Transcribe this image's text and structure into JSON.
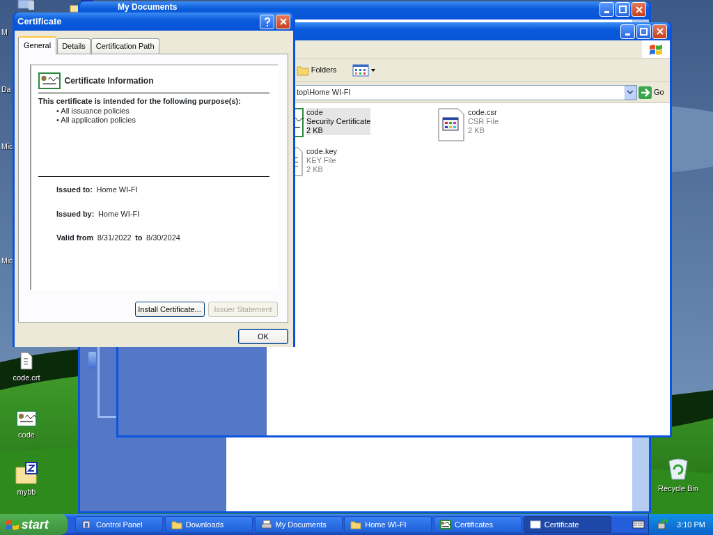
{
  "desktop_icons": [
    {
      "label": "M",
      "kind": "hidden"
    },
    {
      "label": "Da",
      "kind": "hidden"
    },
    {
      "label": "Mic",
      "kind": "hidden"
    },
    {
      "label": "Mic",
      "kind": "hidden"
    },
    {
      "label": "code.crt",
      "kind": "document"
    },
    {
      "label": "code",
      "kind": "certificate"
    },
    {
      "label": "mybb",
      "kind": "zip-folder"
    },
    {
      "label": "Recycle Bin",
      "kind": "recycle-bin"
    }
  ],
  "back_window": {
    "title": "My Documents"
  },
  "explorer": {
    "toolbar": [
      {
        "label": "Folders"
      }
    ],
    "address": "top\\Home WI-FI",
    "go": "Go",
    "files": [
      {
        "name": "code",
        "type": "Security Certificate",
        "size": "2 KB",
        "kind": "certificate",
        "selected": true
      },
      {
        "name": "code.csr",
        "type": "CSR File",
        "size": "2 KB",
        "kind": "window-doc",
        "selected": false
      },
      {
        "name": "code.key",
        "type": "KEY File",
        "size": "2 KB",
        "kind": "document",
        "selected": false
      }
    ]
  },
  "dialog": {
    "title": "Certificate",
    "tabs": [
      {
        "label": "General",
        "selected": true
      },
      {
        "label": "Details",
        "selected": false
      },
      {
        "label": "Certification Path",
        "selected": false
      }
    ],
    "heading": "Certificate Information",
    "purpose_title": "This certificate is intended for the following purpose(s):",
    "purposes": [
      "• All issuance policies",
      "• All application policies"
    ],
    "fields": [
      {
        "label": "Issued to:",
        "value": "Home WI-FI"
      },
      {
        "label": "Issued by:",
        "value": "Home WI-FI"
      }
    ],
    "validity": {
      "from_label": "Valid from",
      "from": "8/31/2022",
      "to_label": "to",
      "to": "8/30/2024"
    },
    "buttons": [
      {
        "label": "Install Certificate...",
        "disabled": false
      },
      {
        "label": "Issuer Statement",
        "disabled": true
      }
    ],
    "ok": "OK"
  },
  "taskbar": {
    "start": "start",
    "tasks": [
      {
        "label": "Control Panel",
        "kind": "control-panel",
        "selected": false
      },
      {
        "label": "Downloads",
        "kind": "folder",
        "selected": false
      },
      {
        "label": "My Documents",
        "kind": "printer",
        "selected": false
      },
      {
        "label": "Home WI-FI",
        "kind": "folder",
        "selected": false
      },
      {
        "label": "Certificates",
        "kind": "certificate",
        "selected": false
      },
      {
        "label": "Certificate",
        "kind": "window",
        "selected": true
      }
    ],
    "clock": "3:10 PM"
  }
}
